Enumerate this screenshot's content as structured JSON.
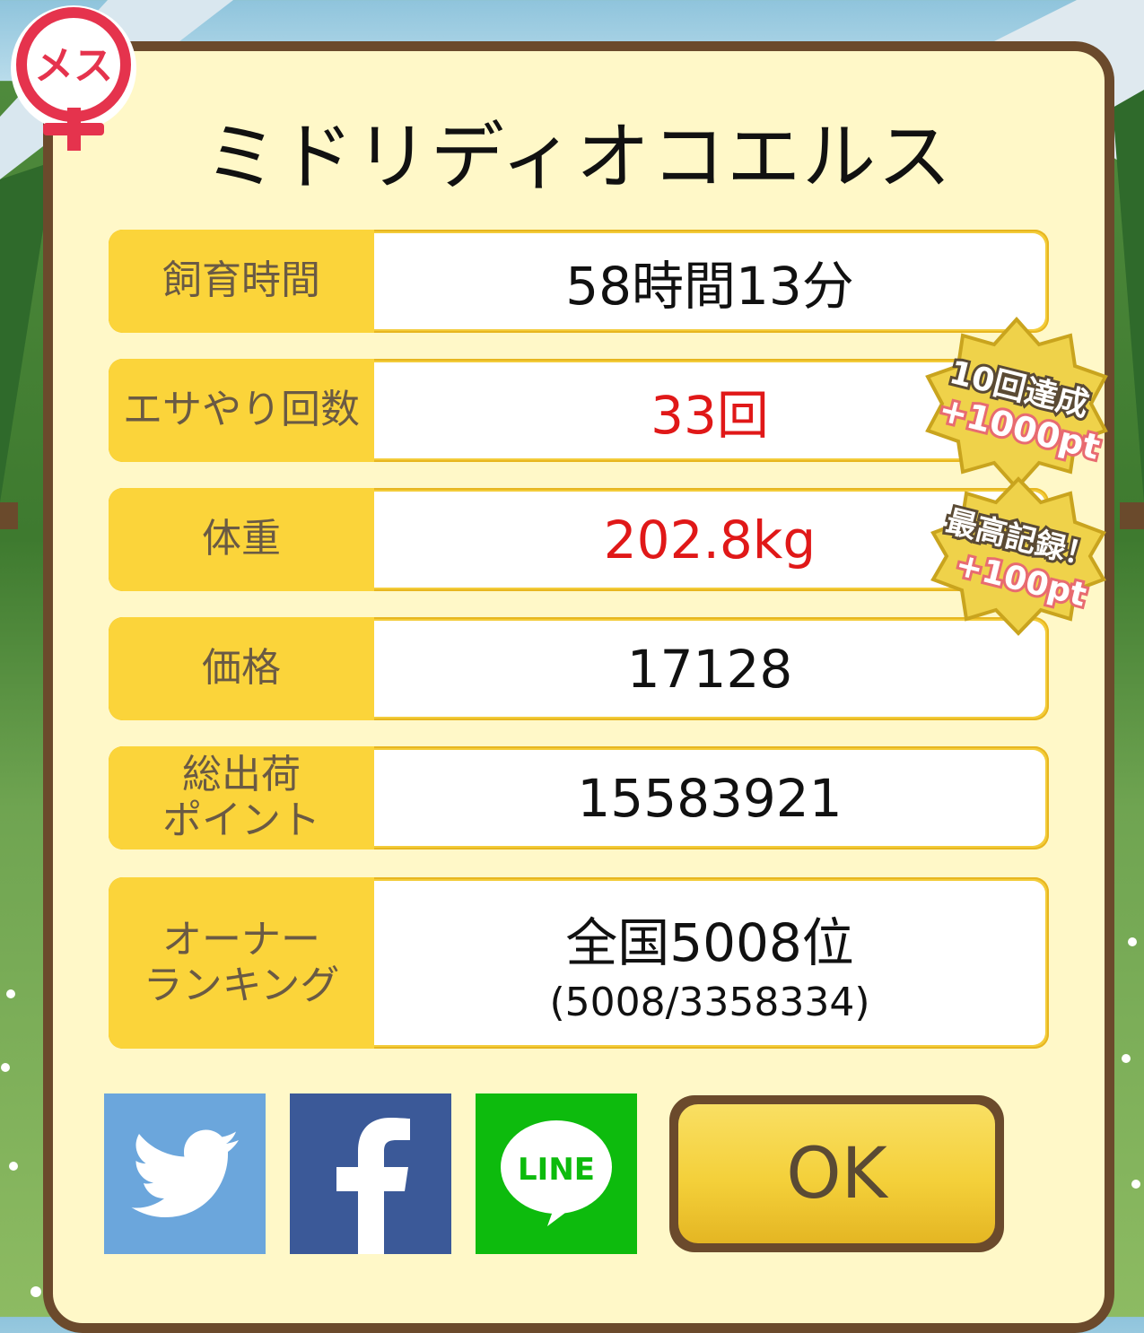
{
  "gender_label": "メス",
  "title": "ミドリディオコエルス",
  "stats": {
    "breeding_time": {
      "label": "飼育時間",
      "value": "58時間13分"
    },
    "feeding_count": {
      "label": "エサやり回数",
      "value": "33回"
    },
    "weight": {
      "label": "体重",
      "value": "202.8kg"
    },
    "price": {
      "label": "価格",
      "value": "17128"
    },
    "total_points": {
      "label_line1": "総出荷",
      "label_line2": "ポイント",
      "value": "15583921"
    },
    "owner_ranking": {
      "label_line1": "オーナー",
      "label_line2": "ランキング",
      "value": "全国5008位",
      "sub_value": "(5008/3358334)"
    }
  },
  "badges": {
    "feeding": {
      "line1": "10回達成",
      "line2": "+1000pt"
    },
    "weight": {
      "line1": "最高記録！",
      "line2": "+100pt"
    }
  },
  "share": {
    "twitter_icon": "twitter-bird-icon",
    "facebook_icon": "facebook-f-icon",
    "line_label": "LINE"
  },
  "ok_label": "OK",
  "colors": {
    "gold": "#fbd43a",
    "panel": "#fff8c8",
    "border": "#6b4a2c",
    "red_value": "#e01818",
    "twitter": "#6ba6dc",
    "facebook": "#3b5998",
    "line": "#0dbb0d",
    "gender": "#e5334d"
  }
}
